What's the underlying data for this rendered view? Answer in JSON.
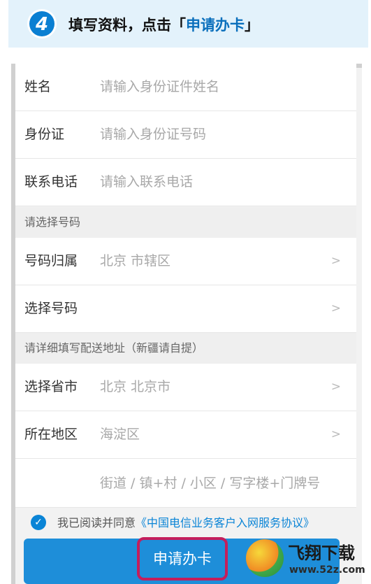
{
  "step": {
    "number": "4",
    "title_prefix": "填写资料，点击「",
    "title_highlight": "申请办卡",
    "title_suffix": "」"
  },
  "form": {
    "name": {
      "label": "姓名",
      "placeholder": "请输入身份证件姓名"
    },
    "id_card": {
      "label": "身份证",
      "placeholder": "请输入身份证号码"
    },
    "phone": {
      "label": "联系电话",
      "placeholder": "请输入联系电话"
    },
    "section_number": "请选择号码",
    "number_region": {
      "label": "号码归属",
      "value": "北京 市辖区",
      "chevron": ">"
    },
    "choose_number": {
      "label": "选择号码",
      "value": "",
      "chevron": ">"
    },
    "section_address": "请详细填写配送地址（新疆请自提）",
    "province_city": {
      "label": "选择省市",
      "value": "北京 北京市",
      "chevron": ">"
    },
    "district": {
      "label": "所在地区",
      "value": "海淀区",
      "chevron": ">"
    },
    "street": {
      "placeholder": "街道 / 镇+村 / 小区 / 写字楼+门牌号"
    }
  },
  "agreement": {
    "check_glyph": "✓",
    "text": "我已阅读并同意",
    "link": "《中国电信业务客户入网服务协议》"
  },
  "submit": {
    "label": "申请办卡"
  },
  "watermark": {
    "title": "飞翔下载",
    "url": "www.52z.com"
  },
  "colors": {
    "accent": "#1e8ed9",
    "highlight_box": "#c41e5c",
    "banner_bg": "#e3f2fb"
  }
}
